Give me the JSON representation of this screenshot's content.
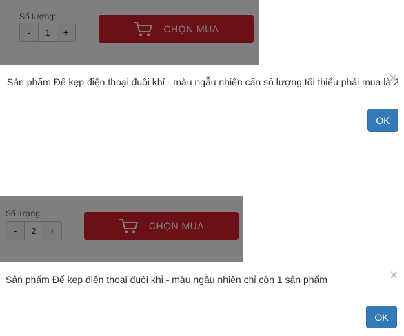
{
  "scene1": {
    "quantity_label": "Số lượng:",
    "decrement_label": "-",
    "quantity_value": "1",
    "increment_label": "+",
    "buy_label": "CHỌN MUA",
    "dialog_message": "Sản phẩm Đế kẹp điện thoại đuôi khỉ - màu ngẫu nhiên cần số lượng tối thiểu phải mua là 2",
    "close_symbol": "×",
    "ok_label": "OK"
  },
  "scene2": {
    "quantity_label": "Số lượng:",
    "decrement_label": "-",
    "quantity_value": "2",
    "increment_label": "+",
    "buy_label": "CHỌN MUA",
    "dialog_message": "Sản phẩm Đế kẹp điện thoại đuôi khỉ - màu ngẫu nhiên chỉ còn 1 sản phẩm",
    "close_symbol": "×",
    "ok_label": "OK"
  },
  "colors": {
    "buy_button": "#d7202c",
    "ok_button": "#337ab7",
    "overlay": "rgba(0,0,0,0.5)"
  },
  "icons": [
    "cart-icon",
    "close-icon"
  ]
}
